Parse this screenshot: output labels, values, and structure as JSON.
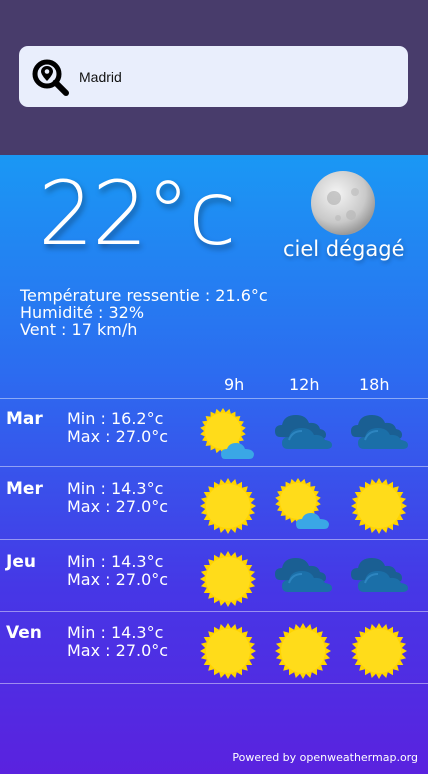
{
  "search": {
    "value": "Madrid",
    "icon": "location-search-icon"
  },
  "current": {
    "temperature": "22°c",
    "condition": "ciel dégagé",
    "icon": "moon-icon",
    "feels_like": "Température ressentie : 21.6°c",
    "humidity": "Humidité : 32%",
    "wind": "Vent : 17 km/h"
  },
  "hours": [
    "9h",
    "12h",
    "18h"
  ],
  "forecast": [
    {
      "day": "Mar",
      "min": "Min : 16.2°c",
      "max": "Max : 27.0°c",
      "icons": [
        "sun-cloud-icon",
        "clouds-icon",
        "clouds-icon"
      ]
    },
    {
      "day": "Mer",
      "min": "Min : 14.3°c",
      "max": "Max : 27.0°c",
      "icons": [
        "sun-icon",
        "sun-cloud-icon",
        "sun-icon"
      ]
    },
    {
      "day": "Jeu",
      "min": "Min : 14.3°c",
      "max": "Max : 27.0°c",
      "icons": [
        "sun-icon",
        "clouds-icon",
        "clouds-icon"
      ]
    },
    {
      "day": "Ven",
      "min": "Min : 14.3°c",
      "max": "Max : 27.0°c",
      "icons": [
        "sun-icon",
        "sun-icon",
        "sun-icon"
      ]
    }
  ],
  "footer": "Powered by openweathermap.org",
  "colors": {
    "header_bg": "#483c6b",
    "gradient_top": "#1a98f4",
    "gradient_bottom": "#5a22df",
    "sun": "#ffd400",
    "cloud": "#1b6fa8"
  }
}
